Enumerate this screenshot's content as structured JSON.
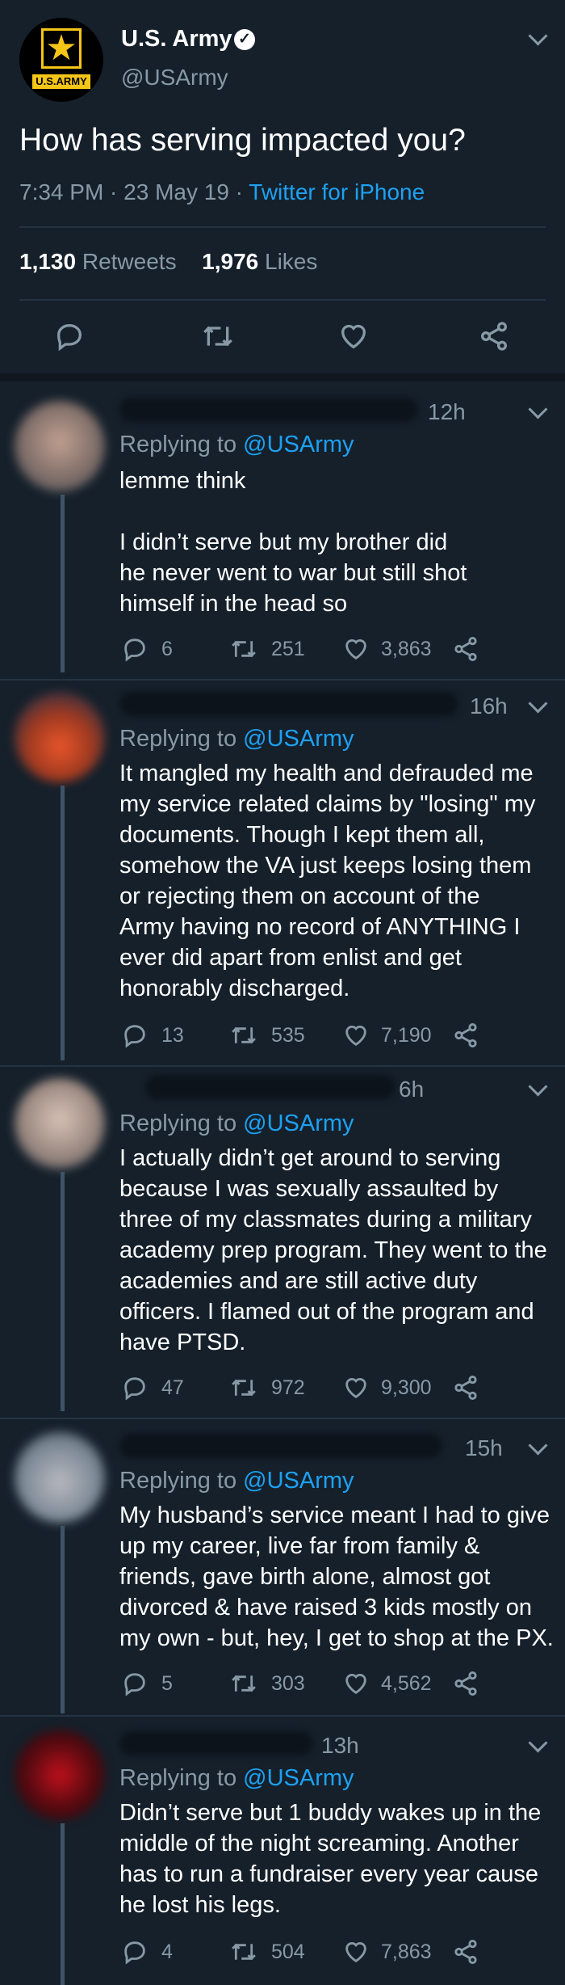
{
  "tweet": {
    "name": "U.S. Army",
    "handle": "@USArmy",
    "logo_text": "U.S.ARMY",
    "text": "How has serving impacted you?",
    "time": "7:34 PM · 23 May 19 · ",
    "source": "Twitter for iPhone",
    "retweets_count": "1,130",
    "retweets_label": "Retweets",
    "likes_count": "1,976",
    "likes_label": "Likes"
  },
  "replies": [
    {
      "time": "12h",
      "replying": "Replying to",
      "to": "@USArmy",
      "text": "lemme think\n\nI didn’t serve but my brother did\nhe never went to war but still shot\nhimself in the head so",
      "replies": "6",
      "retweets": "251",
      "likes": "3,863"
    },
    {
      "time": "16h",
      "replying": "Replying to",
      "to": "@USArmy",
      "text": "It mangled my health and defrauded me\nmy service related claims by \"losing\" my\ndocuments. Though I kept them all,\nsomehow the VA just keeps losing them\nor rejecting them on account of the\nArmy having no record of ANYTHING I\never did apart from enlist and get\nhonorably discharged.",
      "replies": "13",
      "retweets": "535",
      "likes": "7,190"
    },
    {
      "time": "6h",
      "replying": "Replying to",
      "to": "@USArmy",
      "text": "I actually didn’t get around to serving\nbecause I was sexually assaulted by\nthree of my classmates during a military\nacademy prep program. They went to the\nacademies and are still active duty\nofficers. I flamed out of the program and\nhave PTSD.",
      "replies": "47",
      "retweets": "972",
      "likes": "9,300"
    },
    {
      "time": "15h",
      "replying": "Replying to",
      "to": "@USArmy",
      "text": "My husband’s service meant I had to give\nup my career, live far from family &\nfriends, gave birth alone, almost got\ndivorced & have raised 3 kids mostly on\nmy own - but, hey, I get to shop at the PX.",
      "replies": "5",
      "retweets": "303",
      "likes": "4,562"
    },
    {
      "time": "13h",
      "replying": "Replying to",
      "to": "@USArmy",
      "text": "Didn’t serve but 1 buddy wakes up in the\nmiddle of the night screaming. Another\nhas to run a fundraiser every year cause\nhe lost his legs.",
      "replies": "4",
      "retweets": "504",
      "likes": "7,863"
    }
  ]
}
